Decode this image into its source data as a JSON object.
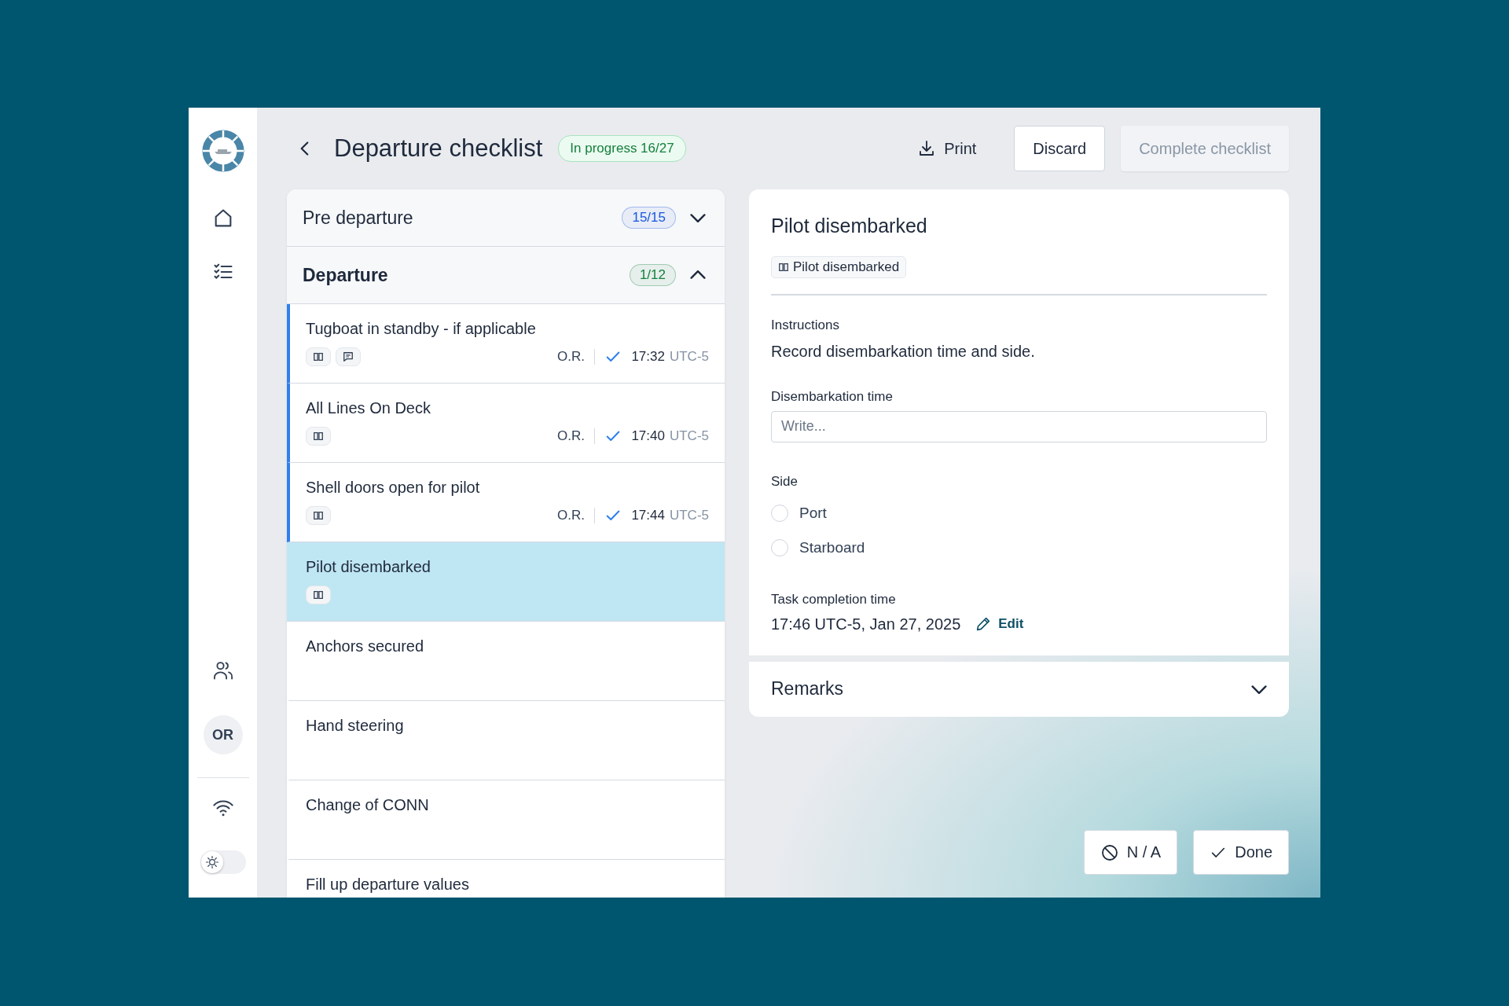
{
  "sidebar": {
    "avatar": "OR",
    "dark_mode": false
  },
  "header": {
    "title": "Departure checklist",
    "status": "In progress 16/27"
  },
  "actions": {
    "print": "Print",
    "discard": "Discard",
    "complete": {
      "label": "Complete checklist",
      "disabled": true
    }
  },
  "sections": [
    {
      "title": "Pre departure",
      "count": "15/15",
      "color": "#1a56db",
      "expanded": false
    },
    {
      "title": "Departure",
      "count": "1/12",
      "color": "#15803d",
      "expanded": true,
      "items": [
        {
          "title": "Tugboat in standby - if applicable",
          "attachments": [
            {
              "kind": "manual"
            },
            {
              "kind": "comment"
            }
          ],
          "done": true,
          "signed_by": "O.R.",
          "time": "17:32",
          "timezone": "UTC-5",
          "selected": false
        },
        {
          "title": "All Lines On Deck",
          "attachments": [
            {
              "kind": "manual"
            }
          ],
          "done": true,
          "signed_by": "O.R.",
          "time": "17:40",
          "timezone": "UTC-5",
          "selected": false
        },
        {
          "title": "Shell doors open for pilot",
          "attachments": [
            {
              "kind": "manual"
            }
          ],
          "done": true,
          "signed_by": "O.R.",
          "time": "17:44",
          "timezone": "UTC-5",
          "selected": false
        },
        {
          "title": "Pilot disembarked",
          "attachments": [
            {
              "kind": "manual"
            }
          ],
          "done": false,
          "selected": true
        },
        {
          "title": "Anchors secured",
          "done": false,
          "selected": false
        },
        {
          "title": "Hand steering",
          "done": false,
          "selected": false
        },
        {
          "title": "Change of CONN",
          "done": false,
          "selected": false
        },
        {
          "title": "Fill up departure values",
          "done": false,
          "selected": false
        }
      ]
    }
  ],
  "detail": {
    "title": "Pilot disembarked",
    "reference": "Pilot disembarked",
    "instructions_label": "Instructions",
    "instructions": "Record disembarkation time and side.",
    "time_field": {
      "label": "Disembarkation time",
      "placeholder": "Write..."
    },
    "side": {
      "label": "Side",
      "options": [
        {
          "label": "Port",
          "selected": false
        },
        {
          "label": "Starboard",
          "selected": false
        }
      ]
    },
    "completion": {
      "label": "Task completion time",
      "value": "17:46 UTC-5, Jan 27, 2025",
      "edit": "Edit"
    },
    "remarks": {
      "title": "Remarks",
      "expanded": false
    }
  },
  "footer": {
    "na": "N / A",
    "done": "Done"
  }
}
